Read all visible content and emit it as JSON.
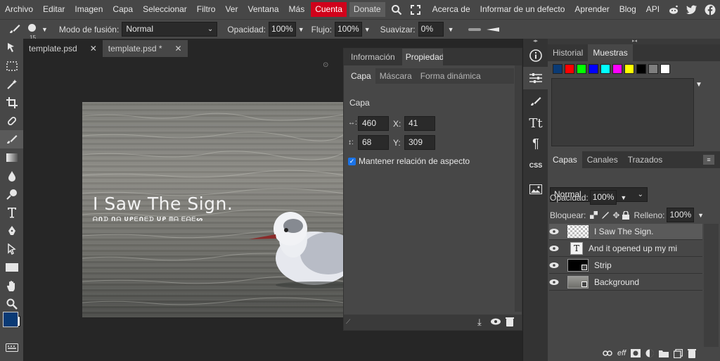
{
  "menu": {
    "items": [
      "Archivo",
      "Editar",
      "Imagen",
      "Capa",
      "Seleccionar",
      "Filtro",
      "Ver",
      "Ventana",
      "Más"
    ],
    "account_label": "Cuenta",
    "donate_label": "Donate",
    "links": [
      "Acerca de",
      "Informar de un defecto",
      "Aprender",
      "Blog",
      "API"
    ]
  },
  "options": {
    "brush_size": "15",
    "blend_label": "Modo de fusión:",
    "blend_value": "Normal",
    "opacity_label": "Opacidad:",
    "opacity_value": "100%",
    "flow_label": "Flujo:",
    "flow_value": "100%",
    "smooth_label": "Suavizar:",
    "smooth_value": "0%"
  },
  "tabs": [
    {
      "label": "template.psd",
      "active": false
    },
    {
      "label": "template.psd *",
      "active": true
    }
  ],
  "canvas": {
    "title_text": "I Saw The Sign.",
    "cipher_text": "ᗩᑎᗪ ᑎᗩ ᑌᑭᗴᑎᗴᗪ ᑌᑭ ᗰᗩ ᗴᗩᗴᔕ"
  },
  "properties": {
    "tabs": [
      "Información",
      "Propiedades"
    ],
    "subtabs": [
      "Capa",
      "Máscara",
      "Forma dinámica"
    ],
    "section_title": "Capa",
    "width_label": "↔:",
    "width_value": "460",
    "x_label": "X:",
    "x_value": "41",
    "height_label": "↕:",
    "height_value": "68",
    "y_label": "Y:",
    "y_value": "309",
    "aspect_label": "Mantener relación de aspecto",
    "aspect_checked": true
  },
  "vstrip": {
    "css_label": "CSS",
    "text_label": "Tt",
    "para_label": "¶"
  },
  "history_panel": {
    "tabs": [
      "Historial",
      "Muestras"
    ],
    "swatches": [
      "#0a3a75",
      "#ff0000",
      "#00ff00",
      "#0000ff",
      "#00ffff",
      "#ff00ff",
      "#ffff00",
      "#000000",
      "#7f7f7f",
      "#ffffff"
    ]
  },
  "layers_panel": {
    "tabs": [
      "Capas",
      "Canales",
      "Trazados"
    ],
    "blend_mode": "Normal",
    "opacity_label": "Opacidad:",
    "opacity_value": "100%",
    "lock_label": "Bloquear:",
    "fill_label": "Relleno:",
    "fill_value": "100%",
    "layers": [
      {
        "name": "I Saw The Sign.",
        "selected": true
      },
      {
        "name": "And it opened up my mi",
        "selected": false
      },
      {
        "name": "Strip",
        "selected": false
      },
      {
        "name": "Background",
        "selected": false
      }
    ],
    "footer_label": "eff"
  },
  "colors": {
    "accent_red": "#d0021b",
    "foreground": "#0a3a75"
  }
}
